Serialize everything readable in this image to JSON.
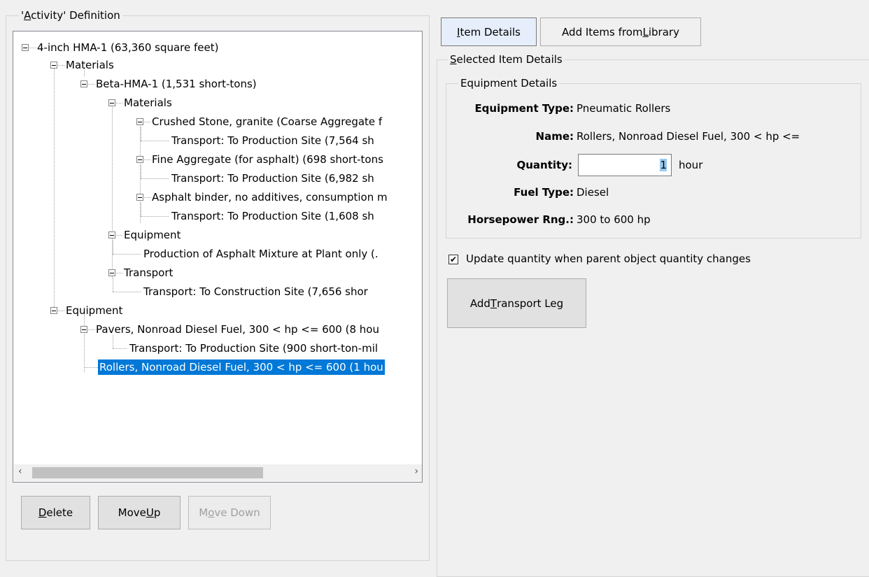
{
  "activity_group": {
    "title": "'Activity' Definition"
  },
  "tree": {
    "nodes": [
      {
        "label": "4-inch HMA-1 (63,360 square feet)"
      },
      {
        "label": "Materials"
      },
      {
        "label": "Beta-HMA-1 (1,531 short-tons)"
      },
      {
        "label": "Materials"
      },
      {
        "label": "Crushed Stone, granite (Coarse Aggregate f"
      },
      {
        "label": "Transport: To Production Site (7,564 sh"
      },
      {
        "label": "Fine Aggregate (for asphalt) (698 short-tons"
      },
      {
        "label": "Transport: To Production Site (6,982 sh"
      },
      {
        "label": "Asphalt binder, no additives, consumption m"
      },
      {
        "label": "Transport: To Production Site (1,608 sh"
      },
      {
        "label": "Equipment"
      },
      {
        "label": "Production of Asphalt Mixture at Plant only (."
      },
      {
        "label": "Transport"
      },
      {
        "label": "Transport: To Construction Site (7,656 shor"
      },
      {
        "label": "Equipment"
      },
      {
        "label": "Pavers, Nonroad Diesel Fuel, 300 < hp <= 600 (8 hou"
      },
      {
        "label": "Transport: To Production Site (900 short-ton-mil"
      },
      {
        "label": "Rollers, Nonroad Diesel Fuel, 300 < hp <= 600 (1 hou"
      }
    ]
  },
  "buttons": {
    "delete": {
      "pre": "",
      "acc": "D",
      "post": "elete"
    },
    "move_up": {
      "pre": "Move ",
      "acc": "U",
      "post": "p"
    },
    "move_down": {
      "pre": "M",
      "acc": "o",
      "post": "ve Down"
    }
  },
  "tabs": {
    "item_details": {
      "pre": "",
      "acc": "I",
      "post": "tem Details"
    },
    "add_library": {
      "pre": "Add Items from ",
      "acc": "L",
      "post": "ibrary"
    }
  },
  "selected_group": {
    "pre": "",
    "acc": "S",
    "post": "elected Item Details"
  },
  "equipment_group": {
    "title": "Equipment Details"
  },
  "details": {
    "equipment_type_label": "Equipment Type:",
    "equipment_type_value": "Pneumatic Rollers",
    "name_label": "Name:",
    "name_value": "Rollers, Nonroad Diesel Fuel, 300 < hp <=",
    "quantity_label": "Quantity:",
    "quantity_value": "1",
    "quantity_unit": "hour",
    "fuel_label": "Fuel Type:",
    "fuel_value": "Diesel",
    "hp_label": "Horsepower Rng.:",
    "hp_value": "300 to 600 hp"
  },
  "update_checkbox": {
    "label": "Update quantity when parent object quantity changes",
    "checked": true
  },
  "transport_button": {
    "pre": "Add ",
    "acc": "T",
    "post": "ransport Leg"
  }
}
